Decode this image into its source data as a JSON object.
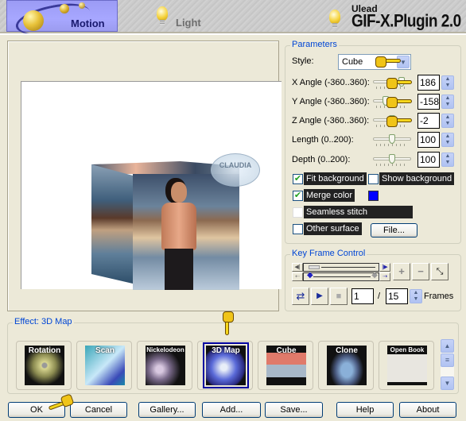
{
  "header": {
    "tabs": [
      {
        "label": "Motion",
        "icon": "planet-icon",
        "active": true
      },
      {
        "label": "Light",
        "icon": "bulb-icon",
        "active": false
      }
    ],
    "brand_small": "Ulead",
    "brand_title": "GIF-X.Plugin 2.0"
  },
  "preview": {
    "watermark": "CLAUDIA"
  },
  "parameters": {
    "title": "Parameters",
    "style_label": "Style:",
    "style_value": "Cube",
    "rows": [
      {
        "label": "X Angle (-360..360):",
        "value": "186",
        "min": -360,
        "max": 360
      },
      {
        "label": "Y Angle (-360..360):",
        "value": "-158",
        "min": -360,
        "max": 360
      },
      {
        "label": "Z Angle (-360..360):",
        "value": "-2",
        "min": -360,
        "max": 360
      },
      {
        "label": "Length (0..200):",
        "value": "100",
        "min": 0,
        "max": 200
      },
      {
        "label": "Depth (0..200):",
        "value": "100",
        "min": 0,
        "max": 200
      }
    ],
    "checkboxes": {
      "fit_background": {
        "label": "Fit background",
        "checked": true
      },
      "show_background": {
        "label": "Show background",
        "checked": false
      },
      "merge_color": {
        "label": "Merge color",
        "checked": true
      },
      "seamless_stitch": {
        "label": "Seamless stitch",
        "checked": false
      },
      "other_surface": {
        "label": "Other surface",
        "checked": false
      }
    },
    "merge_color_value": "#0000ff",
    "file_button": "File..."
  },
  "keyframe": {
    "title": "Key Frame Control",
    "current_frame": "1",
    "separator": "/",
    "total_frames": "15",
    "frames_label": "Frames"
  },
  "effect": {
    "title": "Effect: 3D Map",
    "items": [
      {
        "name": "Rotation",
        "selected": false
      },
      {
        "name": "Scan",
        "selected": false
      },
      {
        "name": "Nickelodeon",
        "selected": false
      },
      {
        "name": "3D Map",
        "selected": true
      },
      {
        "name": "Cube",
        "selected": false
      },
      {
        "name": "Clone",
        "selected": false
      },
      {
        "name": "Open Book",
        "selected": false
      }
    ]
  },
  "buttons": {
    "ok": "OK",
    "cancel": "Cancel",
    "gallery": "Gallery...",
    "add": "Add...",
    "save": "Save...",
    "help": "Help",
    "about": "About"
  }
}
